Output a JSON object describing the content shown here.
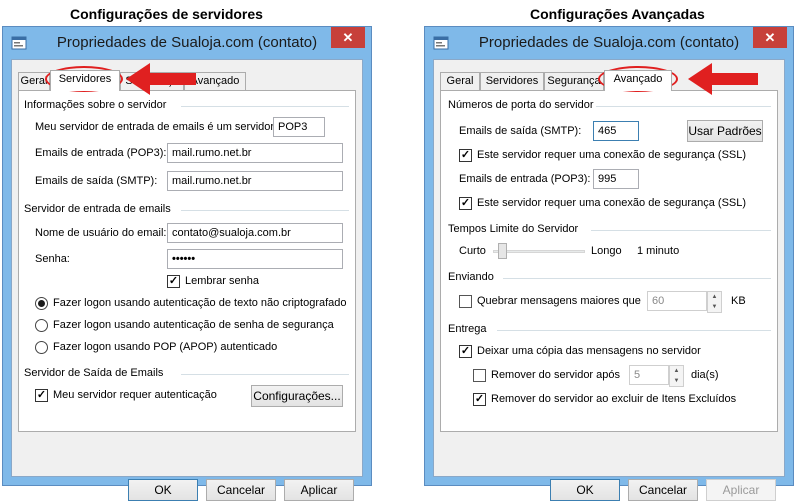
{
  "captions": {
    "left": "Configurações de servidores",
    "right": "Configurações Avançadas"
  },
  "window_title": "Propriedades de Sualoja.com (contato)",
  "close_glyph": "✕",
  "tabs": [
    "Geral",
    "Servidores",
    "Segurança",
    "Avançado"
  ],
  "buttons": {
    "ok": "OK",
    "cancel": "Cancelar",
    "apply": "Aplicar"
  },
  "servers": {
    "info_group": "Informações sobre o servidor",
    "incoming_type_label": "Meu servidor de entrada de emails é um servidor",
    "incoming_type_value": "POP3",
    "incoming_label": "Emails de entrada (POP3):",
    "incoming_value": "mail.rumo.net.br",
    "outgoing_label": "Emails de saída (SMTP):",
    "outgoing_value": "mail.rumo.net.br",
    "incoming_server_group": "Servidor de entrada de emails",
    "username_label": "Nome de usuário do email:",
    "username_value": "contato@sualoja.com.br",
    "password_label": "Senha:",
    "password_value": "••••••",
    "remember_password": "Lembrar senha",
    "remember_checked": true,
    "logon_options": [
      {
        "label": "Fazer logon usando autenticação de texto não criptografado",
        "selected": true
      },
      {
        "label": "Fazer logon usando autenticação de senha de segurança",
        "selected": false
      },
      {
        "label": "Fazer logon usando POP (APOP) autenticado",
        "selected": false
      }
    ],
    "outgoing_server_group": "Servidor de Saída de Emails",
    "requires_auth": "Meu servidor requer autenticação",
    "requires_auth_checked": true,
    "settings_button": "Configurações..."
  },
  "advanced": {
    "ports_group": "Números de porta do servidor",
    "smtp_label": "Emails de saída (SMTP):",
    "smtp_port": "465",
    "use_defaults": "Usar Padrões",
    "ssl_smtp": "Este servidor requer uma conexão de segurança (SSL)",
    "ssl_smtp_checked": true,
    "pop_label": "Emails de entrada (POP3):",
    "pop_port": "995",
    "ssl_pop": "Este servidor requer uma conexão de segurança (SSL)",
    "ssl_pop_checked": true,
    "timeout_group": "Tempos Limite do Servidor",
    "short_label": "Curto",
    "long_label": "Longo",
    "timeout_value": "1 minuto",
    "timeout_level": 0.05,
    "sending_group": "Enviando",
    "split_messages": "Quebrar mensagens maiores que",
    "split_checked": false,
    "split_value": "60",
    "split_unit": "KB",
    "delivery_group": "Entrega",
    "leave_copy": "Deixar uma cópia das mensagens no servidor",
    "leave_copy_checked": true,
    "remove_after": "Remover do servidor após",
    "remove_after_checked": false,
    "remove_after_value": "5",
    "remove_after_unit": "dia(s)",
    "remove_deleted": "Remover do servidor ao excluir de Itens Excluídos",
    "remove_deleted_checked": true
  },
  "colors": {
    "highlight": "#e02020",
    "titlebar": "#7fb9e9",
    "close": "#c7403a"
  },
  "icons": {
    "arrow": "red-arrow-left-icon",
    "up": "spin-up-icon",
    "down": "spin-down-icon"
  }
}
